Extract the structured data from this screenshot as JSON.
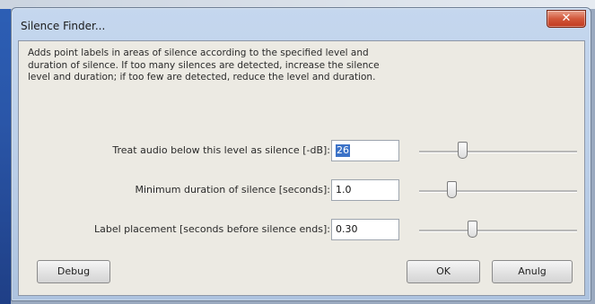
{
  "window": {
    "title": "Silence Finder...",
    "close_glyph": "✕"
  },
  "description": "Adds point labels in areas of silence according to the specified level and duration of silence. If too many silences are detected, increase the silence level and duration; if too few are detected, reduce the level and duration.",
  "parameters": [
    {
      "label": "Treat audio below this level as silence [-dB]:",
      "value": "26",
      "selected": true,
      "slider_fraction": 0.28
    },
    {
      "label": "Minimum duration of silence [seconds]:",
      "value": "1.0",
      "selected": false,
      "slider_fraction": 0.21
    },
    {
      "label": "Label placement [seconds before silence ends]:",
      "value": "0.30",
      "selected": false,
      "slider_fraction": 0.34
    }
  ],
  "buttons": {
    "debug": "Debug",
    "ok": "OK",
    "cancel": "Anulg"
  },
  "colors": {
    "close_button": "#c9472b",
    "selection": "#3b72c7",
    "client_bg": "#eceae3",
    "frame": "#b9cde7"
  },
  "icons": {
    "close": "close-icon"
  }
}
